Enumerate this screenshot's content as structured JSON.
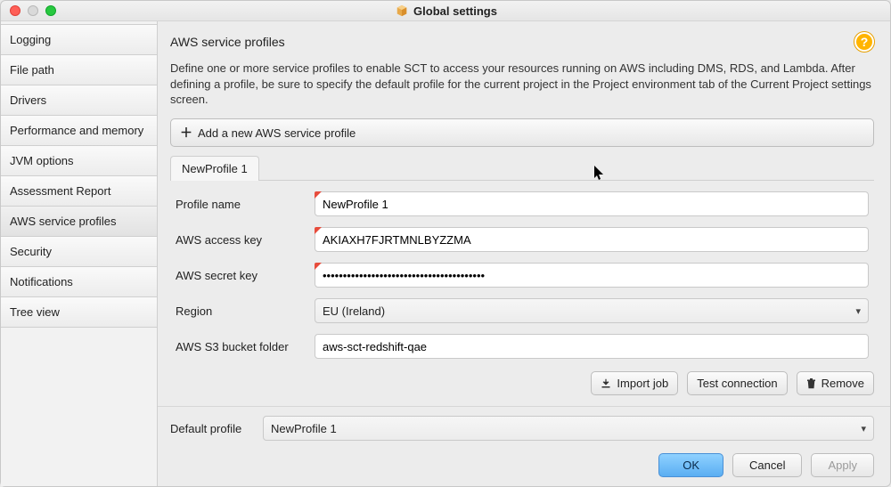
{
  "window": {
    "title": "Global settings"
  },
  "sidebar": {
    "items": [
      {
        "label": "Logging"
      },
      {
        "label": "File path"
      },
      {
        "label": "Drivers"
      },
      {
        "label": "Performance and memory"
      },
      {
        "label": "JVM options"
      },
      {
        "label": "Assessment Report"
      },
      {
        "label": "AWS service profiles"
      },
      {
        "label": "Security"
      },
      {
        "label": "Notifications"
      },
      {
        "label": "Tree view"
      }
    ],
    "active_index": 6
  },
  "main": {
    "heading": "AWS service profiles",
    "description": "Define one or more service profiles to enable SCT to access your resources running on AWS including DMS, RDS, and Lambda. After defining a profile, be sure to specify the default profile for the current project in the Project environment tab of the Current Project settings screen.",
    "add_button": "Add a new AWS service profile",
    "tabs": [
      {
        "label": "NewProfile 1"
      }
    ],
    "form": {
      "profile_name": {
        "label": "Profile name",
        "value": "NewProfile 1"
      },
      "access_key": {
        "label": "AWS access key",
        "value": "AKIAXH7FJRTMNLBYZZMA"
      },
      "secret_key": {
        "label": "AWS secret key",
        "value": "••••••••••••••••••••••••••••••••••••••••"
      },
      "region": {
        "label": "Region",
        "value": "EU (Ireland)"
      },
      "s3_folder": {
        "label": "AWS S3 bucket folder",
        "value": "aws-sct-redshift-qae"
      }
    },
    "actions": {
      "import_job": "Import job",
      "test_connection": "Test connection",
      "remove": "Remove"
    },
    "default_profile": {
      "label": "Default profile",
      "value": "NewProfile 1"
    }
  },
  "footer": {
    "ok": "OK",
    "cancel": "Cancel",
    "apply": "Apply"
  },
  "help_glyph": "?"
}
